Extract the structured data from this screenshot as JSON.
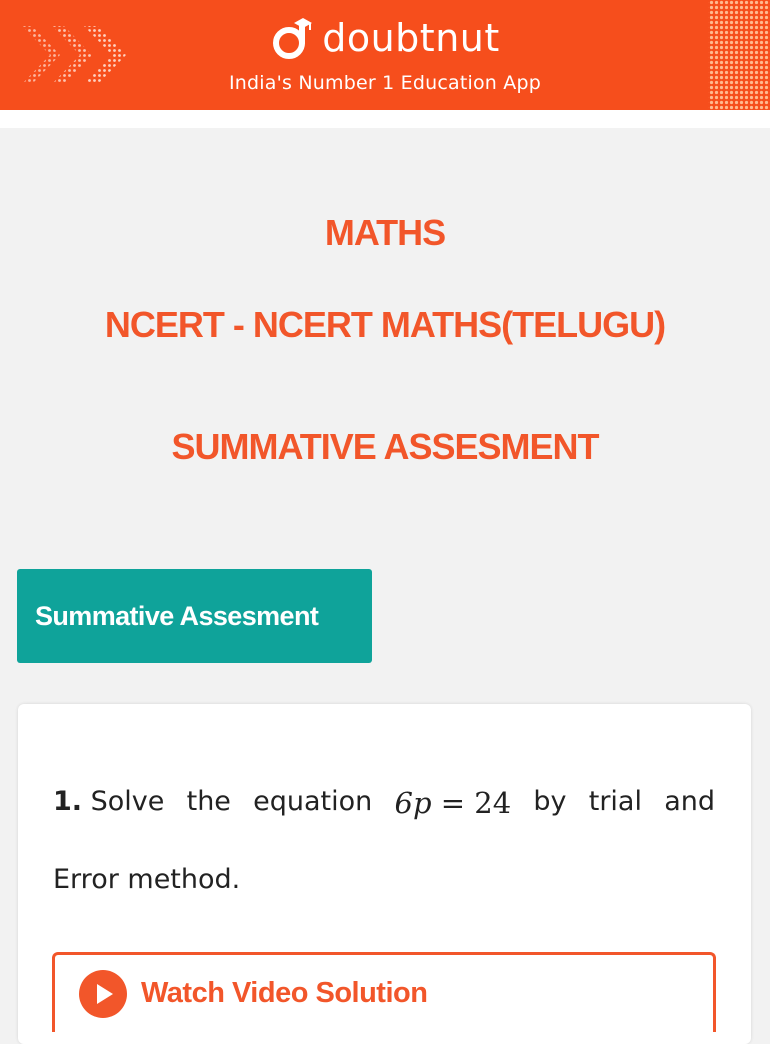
{
  "banner": {
    "brand": "doubtnut",
    "tagline": "India's Number 1 Education App",
    "background_color": "#f64e1c",
    "logo_icon": "doubtnut-d-icon"
  },
  "headings": {
    "subject": "MATHS",
    "book": "NCERT - NCERT MATHS(TELUGU)",
    "chapter": "SUMMATIVE ASSESMENT",
    "color": "#f2562a"
  },
  "tag_button": {
    "label": "Summative Assesment",
    "color": "#0fa39a"
  },
  "question": {
    "number": "1.",
    "words_line1": [
      "Solve",
      "the",
      "equation",
      "by",
      "trial",
      "and"
    ],
    "equation": {
      "lhs": "6p",
      "operator": "=",
      "rhs": "24"
    },
    "line2": "Error method."
  },
  "watch_button": {
    "label": "Watch Video Solution",
    "icon": "play-icon",
    "color": "#f2562a"
  }
}
